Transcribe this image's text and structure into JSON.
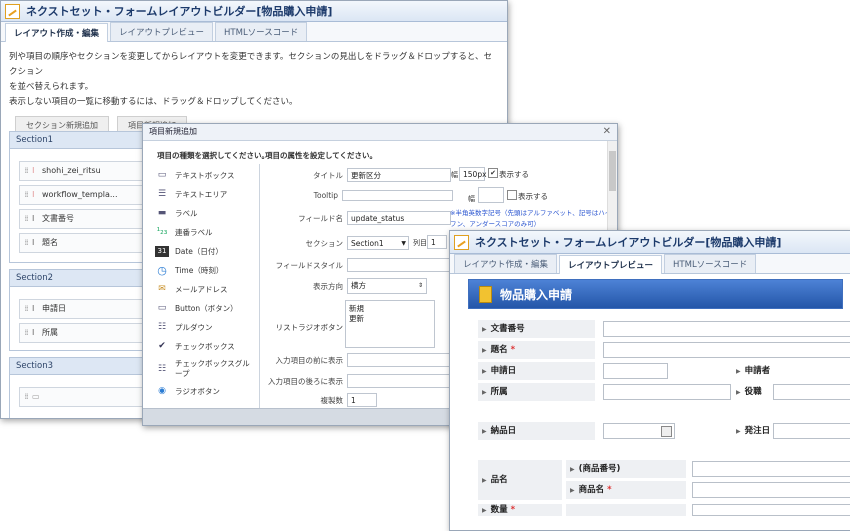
{
  "back": {
    "title": "ネクストセット・フォームレイアウトビルダー[物品購入申請]",
    "tabs": [
      "レイアウト作成・編集",
      "レイアウトプレビュー",
      "HTMLソースコード"
    ],
    "desc1": "列や項目の順序やセクションを変更してからレイアウトを変更できます。セクションの見出しをドラッグ＆ドロップすると、セクション",
    "desc2": "を並べ替えられます。",
    "desc3": "表示しない項目の一覧に移動するには、ドラッグ＆ドロップしてください。",
    "btn_add_section": "セクション新規追加",
    "btn_add_item": "項目新規追加",
    "section1": "Section1",
    "section2": "Section2",
    "section3": "Section3",
    "s1_fields": [
      "shohi_zei_ritsu",
      "workflow_templa...",
      "文書番号",
      "題名"
    ],
    "s2_fields": [
      "申請日",
      "所属"
    ]
  },
  "dialog": {
    "title": "項目新規追加",
    "close": "✕",
    "type_heading": "項目の種類を選択してください。",
    "attr_heading": "項目の属性を設定してください。",
    "types": [
      {
        "icon": "textbox-icon",
        "glyph": "▭",
        "label": "テキストボックス"
      },
      {
        "icon": "textarea-icon",
        "glyph": "☰",
        "label": "テキストエリア"
      },
      {
        "icon": "label-icon",
        "glyph": "▬",
        "label": "ラベル"
      },
      {
        "icon": "serial-label-icon",
        "glyph": "¹₂₃",
        "label": "連番ラベル"
      },
      {
        "icon": "date-icon",
        "glyph": "31",
        "label": "Date（日付）"
      },
      {
        "icon": "time-icon",
        "glyph": "◷",
        "label": "Time（時刻）"
      },
      {
        "icon": "mail-icon",
        "glyph": "✉",
        "label": "メールアドレス"
      },
      {
        "icon": "button-icon",
        "glyph": "▭",
        "label": "Button（ボタン）"
      },
      {
        "icon": "pulldown-icon",
        "glyph": "☷",
        "label": "プルダウン"
      },
      {
        "icon": "checkbox-icon",
        "glyph": "✔",
        "label": "チェックボックス"
      },
      {
        "icon": "checkbox-group-icon",
        "glyph": "☷",
        "label": "チェックボックスグループ"
      },
      {
        "icon": "radio-icon",
        "glyph": "◉",
        "label": "ラジオボタン"
      }
    ],
    "labels": {
      "title": "タイトル",
      "tooltip": "Tooltip",
      "field_name": "フィールド名",
      "section": "セクション",
      "field_style": "フィールドスタイル",
      "direction": "表示方向",
      "list_radio": "リストラジオボタン",
      "before": "入力項目の前に表示",
      "after": "入力項目の後ろに表示",
      "copies": "複製数"
    },
    "values": {
      "title": "更新区分",
      "width_label": "幅",
      "width_value": "150px",
      "show_label": "表示する",
      "show_label2": "表示する",
      "field_name": "update_status",
      "section": "Section1",
      "column_label": "列目",
      "column_value": "1",
      "direction": "横方",
      "list_items": [
        "新規",
        "更新"
      ],
      "copies": "1",
      "note": "※半角英数字記号（先頭はアルファベット、記号はハイフン、アンダースコアのみ可）"
    }
  },
  "front": {
    "title": "ネクストセット・フォームレイアウトビルダー[物品購入申請]",
    "tabs": [
      "レイアウト作成・編集",
      "レイアウトプレビュー",
      "HTMLソースコード"
    ],
    "form_title": "物品購入申請",
    "labels": {
      "doc_no": "文書番号",
      "subject": "題名",
      "apply_date": "申請日",
      "applicant": "申請者",
      "dept": "所属",
      "position": "役職",
      "delivery": "納品日",
      "order_date": "発注日",
      "item_name": "品名",
      "product_no": "(商品番号)",
      "product_name": "商品名",
      "partial": "数量"
    },
    "required_mark": "*"
  }
}
